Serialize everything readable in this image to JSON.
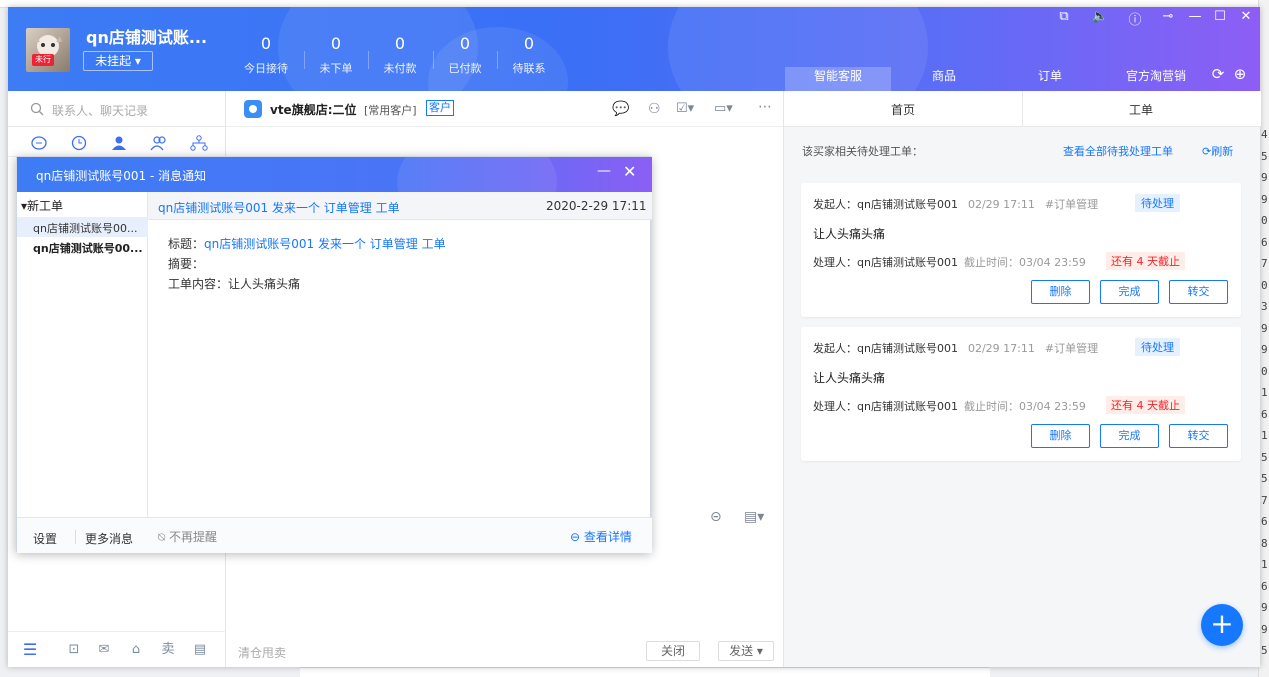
{
  "header": {
    "shop_name": "qn店铺测试账...",
    "status": "未挂起",
    "avatar_badge": "未行",
    "stats": [
      {
        "value": "0",
        "label": "今日接待"
      },
      {
        "value": "0",
        "label": "未下单"
      },
      {
        "value": "0",
        "label": "未付款"
      },
      {
        "value": "0",
        "label": "已付款"
      },
      {
        "value": "0",
        "label": "待联系"
      }
    ],
    "nav_tabs": [
      "智能客服",
      "商品",
      "订单",
      "官方淘营销"
    ]
  },
  "left": {
    "search_placeholder": "联系人、聊天记录",
    "bottom_icons": [
      "menu-icon",
      "finance-icon",
      "mail-icon",
      "store-icon",
      "sell-icon",
      "layout-icon"
    ],
    "sell_label": "卖"
  },
  "chat": {
    "title": "vte旗舰店:二位",
    "tag": "[常用客户]",
    "badge": "客户",
    "input_placeholder": "清仓甩卖",
    "close_label": "关闭",
    "send_label": "发送"
  },
  "right": {
    "tabs": [
      "首页",
      "工单"
    ],
    "pending_label": "该买家相关待处理工单：",
    "view_all": "查看全部待我处理工单",
    "refresh": "刷新",
    "cards": [
      {
        "initiator": "发起人：qn店铺测试账号001",
        "date": "02/29 17:11",
        "category": "#订单管理",
        "status": "待处理",
        "title": "让人头痛头痛",
        "handler": "处理人：qn店铺测试账号001",
        "deadline": "截止时间：03/04 23:59",
        "due": "还有 4 天截止",
        "actions": [
          "删除",
          "完成",
          "转交"
        ]
      },
      {
        "initiator": "发起人：qn店铺测试账号001",
        "date": "02/29 17:11",
        "category": "#订单管理",
        "status": "待处理",
        "title": "让人头痛头痛",
        "handler": "处理人：qn店铺测试账号001",
        "deadline": "截止时间：03/04 23:59",
        "due": "还有 4 天截止",
        "actions": [
          "删除",
          "完成",
          "转交"
        ]
      }
    ]
  },
  "popup": {
    "title": "qn店铺测试账号001 - 消息通知",
    "tree_root": "新工单",
    "tree_items": [
      "qn店铺测试账号00...",
      "qn店铺测试账号00..."
    ],
    "message_link": "qn店铺测试账号001 发来一个 订单管理 工单",
    "message_time": "2020-2-29 17:11",
    "title_label": "标题：",
    "title_value": "qn店铺测试账号001 发来一个 订单管理 工单",
    "summary_label": "摘要：",
    "content_label": "工单内容：让人头痛头痛",
    "settings": "设置",
    "more": "更多消息",
    "mute": "不再提醒",
    "detail": "查看详情"
  },
  "edge_digits": [
    "4",
    "5",
    "9",
    "9",
    "0",
    "6",
    "7",
    "0",
    "3",
    "9",
    "9",
    "0",
    "1",
    "6",
    "1",
    "5",
    "5",
    "7",
    "6",
    "8",
    "1",
    "6",
    "9",
    "9",
    "5"
  ],
  "colors": {
    "primary": "#1677ff",
    "header_start": "#3d7cf5",
    "header_end": "#8d5ef5",
    "danger": "#f5222d"
  }
}
